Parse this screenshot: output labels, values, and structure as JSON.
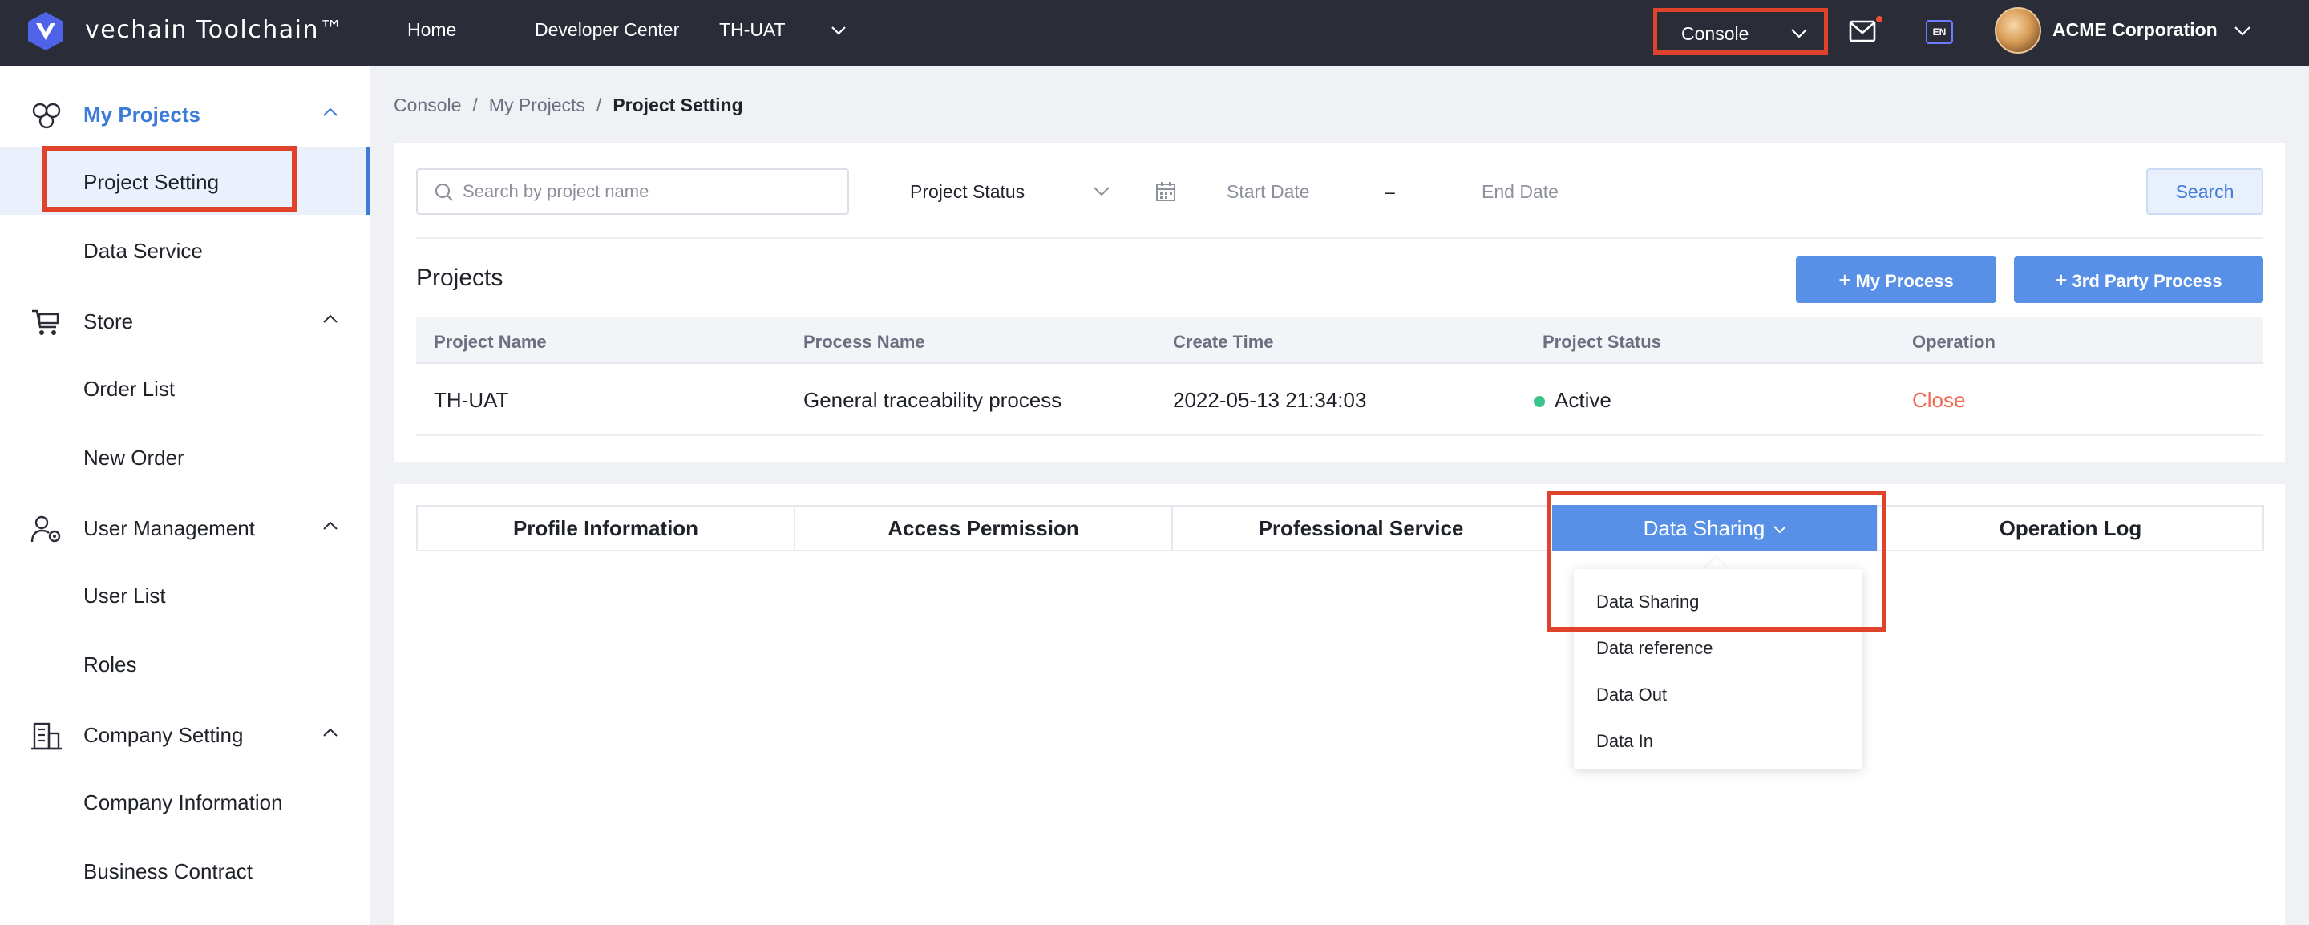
{
  "topbar": {
    "brand": "vechain Toolchain™",
    "nav": [
      "Home",
      "Developer Center",
      "TH-UAT"
    ],
    "console_label": "Console",
    "lang": "EN",
    "company": "ACME Corporation"
  },
  "sidebar": {
    "groups": [
      {
        "label": "My Projects",
        "icon": "projects-icon",
        "items": [
          "Project Setting",
          "Data Service"
        ]
      },
      {
        "label": "Store",
        "icon": "store-cart-icon",
        "items": [
          "Order List",
          "New Order"
        ]
      },
      {
        "label": "User Management",
        "icon": "user-management-icon",
        "items": [
          "User List",
          "Roles"
        ]
      },
      {
        "label": "Company Setting",
        "icon": "company-building-icon",
        "items": [
          "Company Information",
          "Business Contract"
        ]
      }
    ]
  },
  "breadcrumb": [
    "Console",
    "My Projects",
    "Project Setting"
  ],
  "filters": {
    "search_placeholder": "Search by project name",
    "status_label": "Project Status",
    "start_date": "Start Date",
    "date_separator": "–",
    "end_date": "End Date",
    "search_button": "Search"
  },
  "projects": {
    "title": "Projects",
    "buttons": [
      "My Process",
      "3rd Party Process"
    ],
    "columns": [
      "Project Name",
      "Process Name",
      "Create Time",
      "Project Status",
      "Operation"
    ],
    "rows": [
      {
        "name": "TH-UAT",
        "process": "General traceability process",
        "created": "2022-05-13 21:34:03",
        "status": "Active",
        "operation": "Close"
      }
    ]
  },
  "tabs": {
    "items": [
      "Profile Information",
      "Access Permission",
      "Professional Service",
      "Data Sharing",
      "Operation Log"
    ],
    "active": "Data Sharing",
    "dropdown": [
      "Data Sharing",
      "Data reference",
      "Data Out",
      "Data In"
    ]
  },
  "colors": {
    "topbar": "#2a2c37",
    "accent": "#5790e6",
    "highlight": "#e0432b",
    "status_active": "#39c489",
    "danger_link": "#ef6a55"
  }
}
